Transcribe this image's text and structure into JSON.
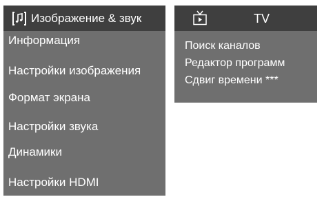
{
  "picture_sound_menu": {
    "header": {
      "icon": "music-note-icon",
      "title": "Изображение & звук"
    },
    "items": [
      {
        "label": "Информация"
      },
      {
        "label": "Настройки изображения"
      },
      {
        "label": "Формат экрана"
      },
      {
        "label": "Настройки звука"
      },
      {
        "label": "Динамики"
      },
      {
        "label": "Настройки HDMI"
      }
    ]
  },
  "tv_menu": {
    "header": {
      "icon": "tv-icon",
      "title": "TV"
    },
    "items": [
      {
        "label": "Поиск каналов"
      },
      {
        "label": "Редактор программ"
      },
      {
        "label": "Сдвиг времени ***"
      }
    ]
  },
  "colors": {
    "panel_background": "#6f6f6f",
    "header_background": "#3f3f3f",
    "text": "#ffffff"
  }
}
